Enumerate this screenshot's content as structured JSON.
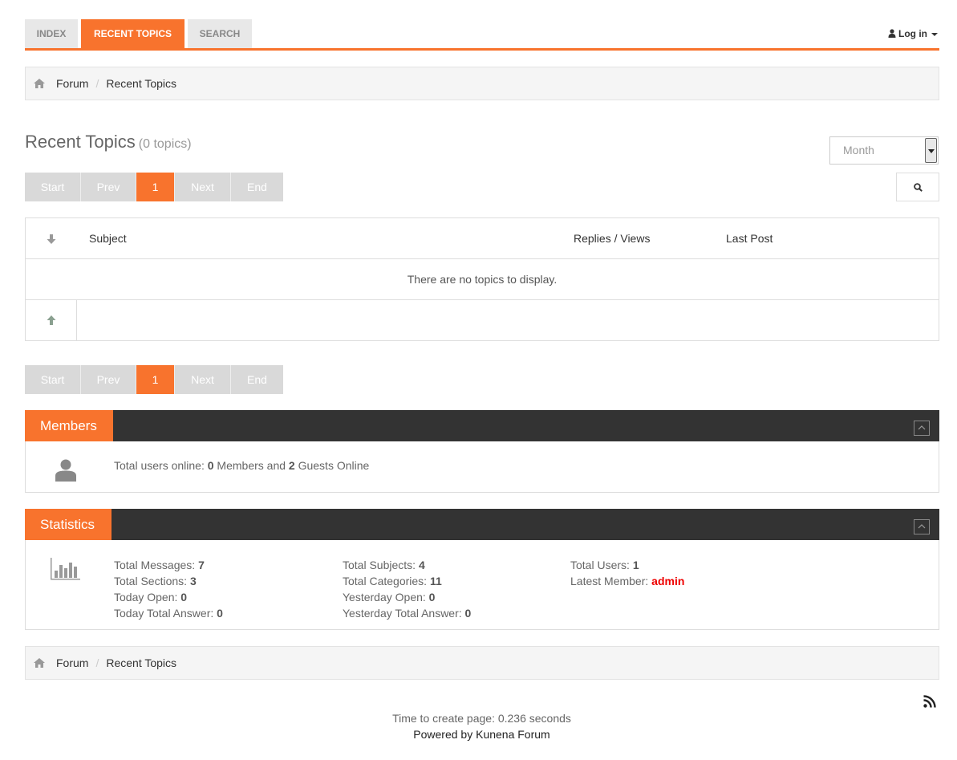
{
  "nav": {
    "tabs": [
      {
        "label": "INDEX"
      },
      {
        "label": "RECENT TOPICS"
      },
      {
        "label": "SEARCH"
      }
    ],
    "login_label": "Log in"
  },
  "breadcrumb": {
    "items": [
      "Forum",
      "Recent Topics"
    ],
    "separator": "/"
  },
  "heading": {
    "title": "Recent Topics",
    "count": "(0 topics)"
  },
  "filter": {
    "period": "Month"
  },
  "pagination": {
    "start": "Start",
    "prev": "Prev",
    "current": "1",
    "next": "Next",
    "end": "End"
  },
  "table": {
    "columns": [
      "Subject",
      "Replies / Views",
      "Last Post"
    ],
    "empty_message": "There are no topics to display."
  },
  "members": {
    "title": "Members",
    "online_prefix": "Total users online:",
    "members_count": "0",
    "members_label": "Members and",
    "guests_count": "2",
    "guests_label": "Guests Online"
  },
  "statistics": {
    "title": "Statistics",
    "col1": [
      {
        "label": "Total Messages:",
        "value": "7"
      },
      {
        "label": "Total Sections:",
        "value": "3"
      },
      {
        "label": "Today Open:",
        "value": "0"
      },
      {
        "label": "Today Total Answer:",
        "value": "0"
      }
    ],
    "col2": [
      {
        "label": "Total Subjects:",
        "value": "4"
      },
      {
        "label": "Total Categories:",
        "value": "11"
      },
      {
        "label": "Yesterday Open:",
        "value": "0"
      },
      {
        "label": "Yesterday Total Answer:",
        "value": "0"
      }
    ],
    "col3": [
      {
        "label": "Total Users:",
        "value": "1"
      },
      {
        "label": "Latest Member:",
        "value": "admin"
      }
    ]
  },
  "footer": {
    "time_text": "Time to create page: 0.236 seconds",
    "powered_text": "Powered by Kunena Forum"
  },
  "colors": {
    "accent": "#f8732d",
    "section_bar": "#333333",
    "latest_member": "#ee0000"
  },
  "icons": [
    "home-icon",
    "user-icon",
    "caret-down-icon",
    "search-icon",
    "arrow-down-icon",
    "arrow-up-icon",
    "collapse-icon",
    "user-silhouette-icon",
    "bar-chart-icon",
    "rss-icon"
  ]
}
